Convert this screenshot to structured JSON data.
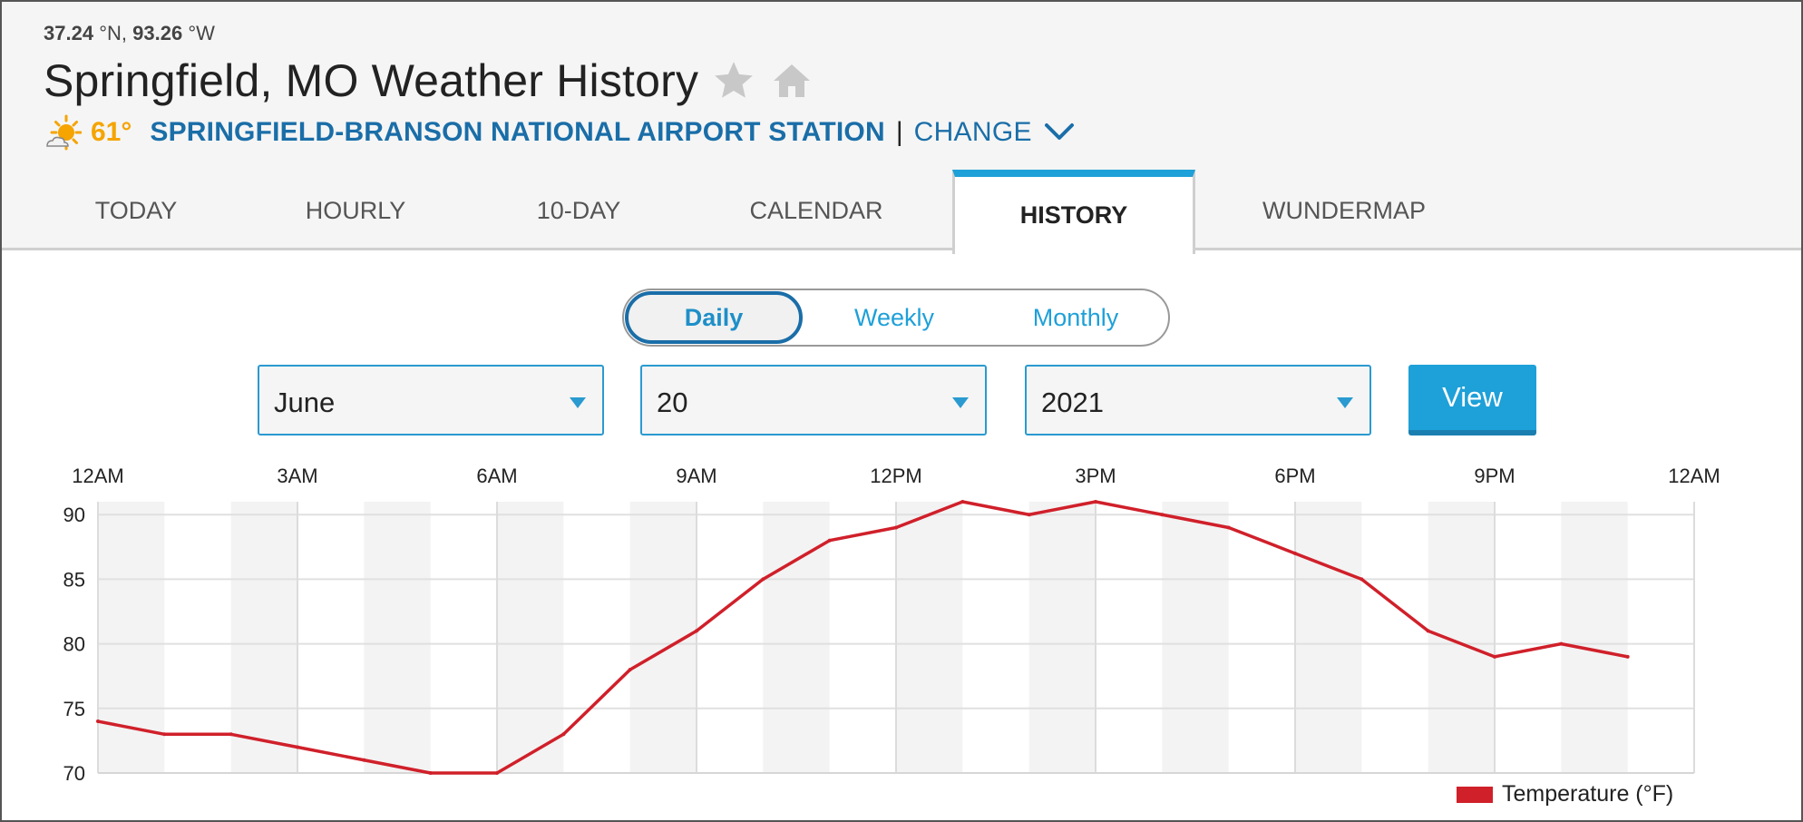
{
  "header": {
    "coords": {
      "lat_value": "37.24",
      "lat_unit": "°N,",
      "lon_value": "93.26",
      "lon_unit": "°W"
    },
    "title": "Springfield, MO Weather History",
    "current_temp": "61°",
    "station_name": "SPRINGFIELD-BRANSON NATIONAL AIRPORT STATION",
    "separator": "|",
    "change_label": "CHANGE"
  },
  "tabs": [
    {
      "label": "TODAY",
      "active": false
    },
    {
      "label": "HOURLY",
      "active": false
    },
    {
      "label": "10-DAY",
      "active": false
    },
    {
      "label": "CALENDAR",
      "active": false
    },
    {
      "label": "HISTORY",
      "active": true
    },
    {
      "label": "WUNDERMAP",
      "active": false
    }
  ],
  "period_toggle": {
    "options": [
      "Daily",
      "Weekly",
      "Monthly"
    ],
    "selected": "Daily"
  },
  "date_selectors": {
    "month": "June",
    "day": "20",
    "year": "2021",
    "view_button": "View"
  },
  "colors": {
    "accent": "#1ea0d8",
    "station_link": "#1a6ea8",
    "temp_text": "#f5a400",
    "series_line": "#d0202a"
  },
  "chart_data": {
    "type": "line",
    "x_tick_labels": [
      "12AM",
      "3AM",
      "6AM",
      "9AM",
      "12PM",
      "3PM",
      "6PM",
      "9PM",
      "12AM"
    ],
    "x_hours": [
      0,
      1,
      2,
      3,
      4,
      5,
      6,
      7,
      8,
      9,
      10,
      11,
      12,
      13,
      14,
      15,
      16,
      17,
      18,
      19,
      20,
      21,
      22,
      23
    ],
    "series": [
      {
        "name": "Temperature (°F)",
        "color": "#d0202a",
        "values": [
          74,
          73,
          73,
          72,
          71,
          70,
          70,
          73,
          78,
          81,
          85,
          88,
          89,
          91,
          90,
          91,
          90,
          89,
          87,
          85,
          81,
          79,
          80,
          79
        ]
      }
    ],
    "x_range_hours": [
      0,
      24
    ],
    "ylim": [
      70,
      91
    ],
    "y_ticks": [
      70,
      75,
      80,
      85,
      90
    ],
    "grid": true,
    "legend": "bottom-right"
  }
}
